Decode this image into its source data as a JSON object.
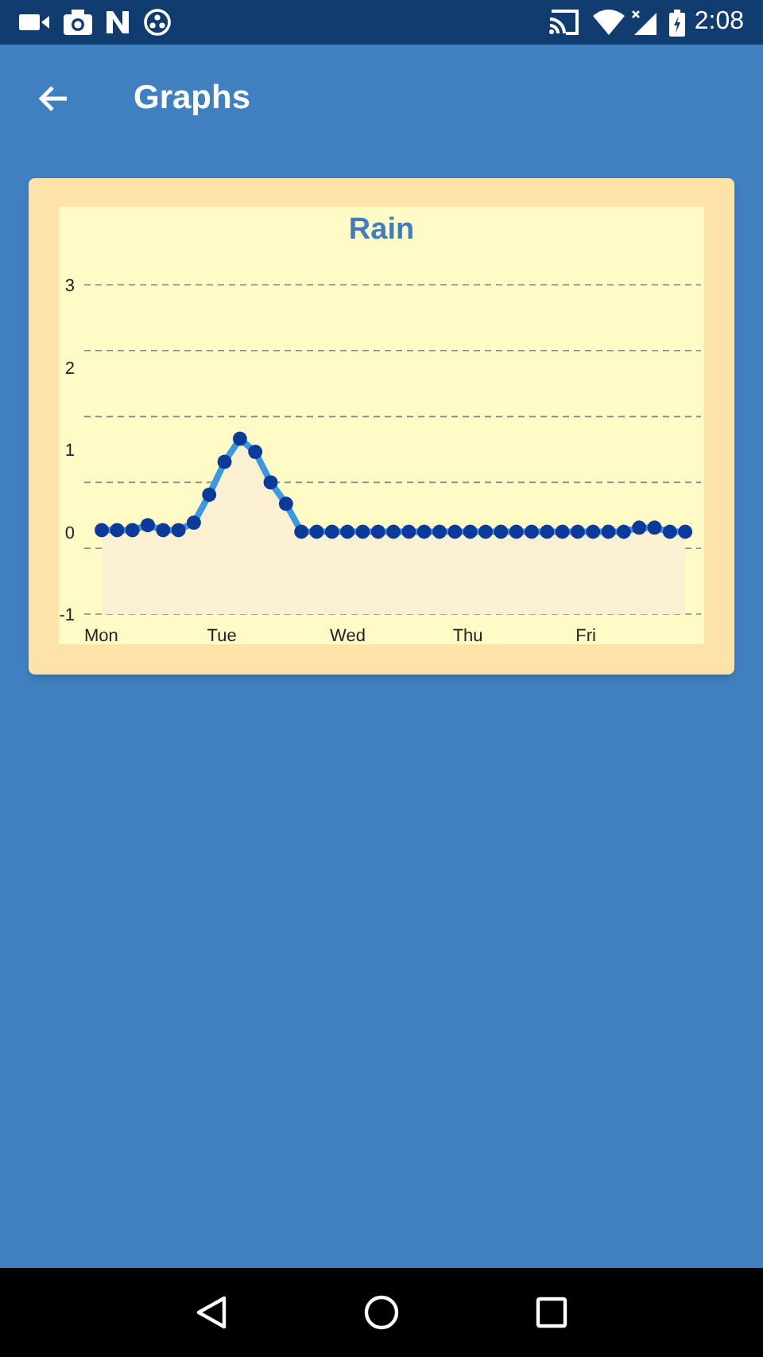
{
  "status_bar": {
    "time": "2:08"
  },
  "app_bar": {
    "title": "Graphs"
  },
  "chart_card": {
    "chart_data": {
      "type": "line",
      "title": "Rain",
      "categories": [
        "Mon",
        null,
        null,
        null,
        null,
        null,
        null,
        null,
        "Tue",
        null,
        null,
        null,
        null,
        null,
        null,
        null,
        "Wed",
        null,
        null,
        null,
        null,
        null,
        null,
        null,
        "Thu",
        null,
        null,
        null,
        null,
        null,
        null,
        null,
        "Fri",
        null,
        null,
        null,
        null,
        null,
        null
      ],
      "series": [
        {
          "color": "#3a9ae0",
          "marker": "circle",
          "values": [
            0.02,
            0.02,
            0.02,
            0.08,
            0.02,
            0.02,
            0.11,
            0.45,
            0.85,
            1.13,
            0.97,
            0.6,
            0.34,
            0,
            0,
            0,
            0,
            0,
            0,
            0,
            0,
            0,
            0,
            0,
            0,
            0,
            0,
            0,
            0,
            0,
            0,
            0,
            0,
            0,
            0,
            0.05,
            0.05,
            0,
            0
          ]
        }
      ],
      "ylim": [
        -1,
        3
      ],
      "yticks": [
        3,
        2,
        1,
        0,
        -1
      ]
    }
  }
}
